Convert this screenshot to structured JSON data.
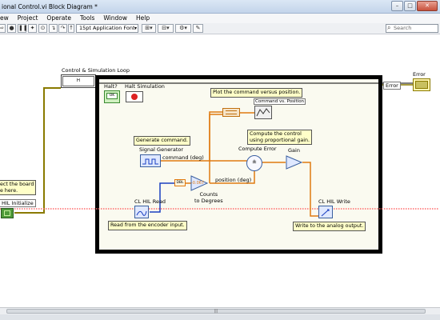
{
  "window": {
    "title": "ional Control.vi Block Diagram *",
    "minimize": "–",
    "maximize": "□",
    "close": "✕"
  },
  "menu": [
    "ew",
    "Project",
    "Operate",
    "Tools",
    "Window",
    "Help"
  ],
  "toolbar": {
    "font_selector": "15pt Application Font",
    "search_placeholder": "Search"
  },
  "diagram": {
    "loop_label": "Control & Simulation Loop",
    "error_label": "Error",
    "error_terminal": "Error",
    "halt_label": "Halt?",
    "halt_button": "OK",
    "halt_simulation": "Halt Simulation",
    "hil_initialize": "HIL Initialize",
    "left_comment": "ect the board\ne here.",
    "comment_plot": "Plot the command versus position.",
    "comment_generate": "Generate command.",
    "comment_compute": "Compute the control\nusing proportional gain.",
    "comment_read": "Read from the encoder input.",
    "comment_write": "Write to the analog output.",
    "graph_label": "Command vs. Position",
    "signal_generator": "Signal Generator",
    "command_label": "command (deg)",
    "compute_error": "Compute Error",
    "gain": "Gain",
    "position_label": "position (deg)",
    "cl_hil_read": "CL HIL Read",
    "cl_hil_write": "CL HIL Write",
    "counts_to_degrees": "Counts\nto Degrees",
    "gain_constant": "-0.067",
    "dbl_tag": "DBL",
    "loop_terminal": "H"
  },
  "colors": {
    "wire_orange": "#e07a10",
    "wire_red_dotted": "#ff6a6a",
    "wire_olive": "#8a7a00",
    "loop_frame": "#000000",
    "comment_bg": "#ffffc8"
  }
}
